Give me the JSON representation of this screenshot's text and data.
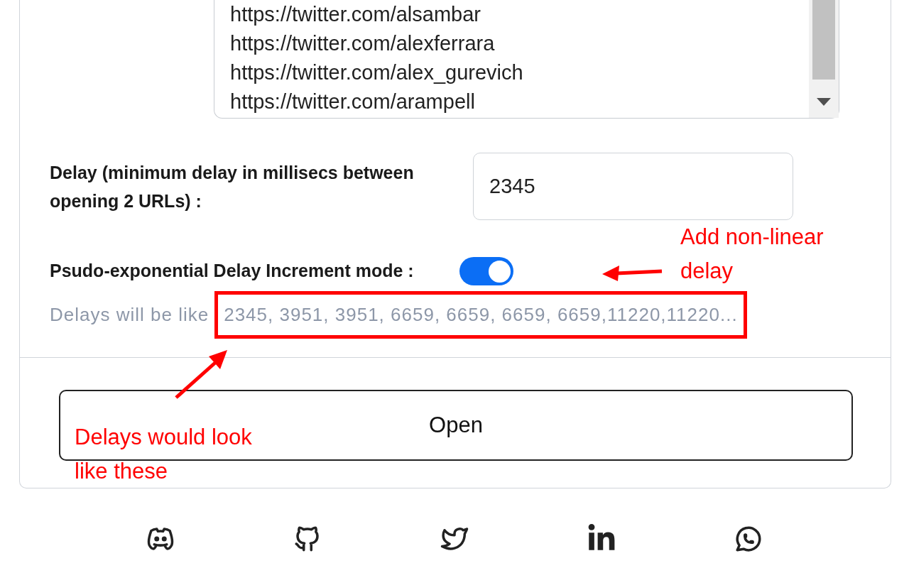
{
  "urls": [
    "https://twitter.com/alsambar",
    "https://twitter.com/alexferrara",
    "https://twitter.com/alex_gurevich",
    "https://twitter.com/arampell"
  ],
  "delay": {
    "label": "Delay (minimum delay in millisecs between opening 2 URLs) :",
    "value": "2345"
  },
  "exponential_mode": {
    "label": "Psudo-exponential Delay Increment mode :",
    "on": true
  },
  "hint": {
    "lead": "Delays will be like",
    "values": "2345, 3951, 3951, 6659, 6659, 6659, 6659,11220,11220..."
  },
  "open_button": "Open",
  "annotations": {
    "toggle_note": [
      "Add non-linear",
      "delay"
    ],
    "delays_note": [
      "Delays would look",
      "like these"
    ]
  }
}
